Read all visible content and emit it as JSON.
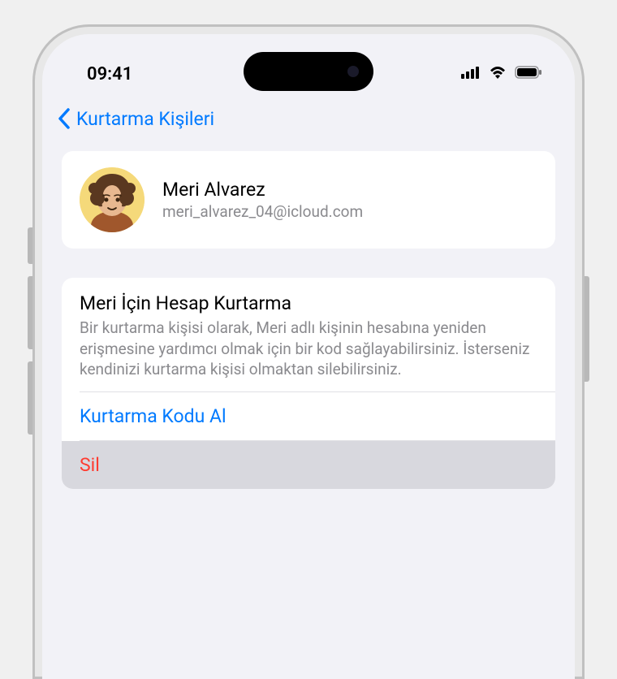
{
  "status": {
    "time": "09:41"
  },
  "nav": {
    "back_label": "Kurtarma Kişileri"
  },
  "contact": {
    "name": "Meri Alvarez",
    "email": "meri_alvarez_04@icloud.com"
  },
  "section": {
    "title": "Meri İçin Hesap Kurtarma",
    "description": "Bir kurtarma kişisi olarak, Meri adlı kişinin hesabına yeniden erişmesine yardımcı olmak için bir kod sağlayabilirsiniz. İsterseniz kendinizi kurtarma kişisi olmaktan silebilirsiniz."
  },
  "actions": {
    "get_code": "Kurtarma Kodu Al",
    "remove": "Sil"
  }
}
